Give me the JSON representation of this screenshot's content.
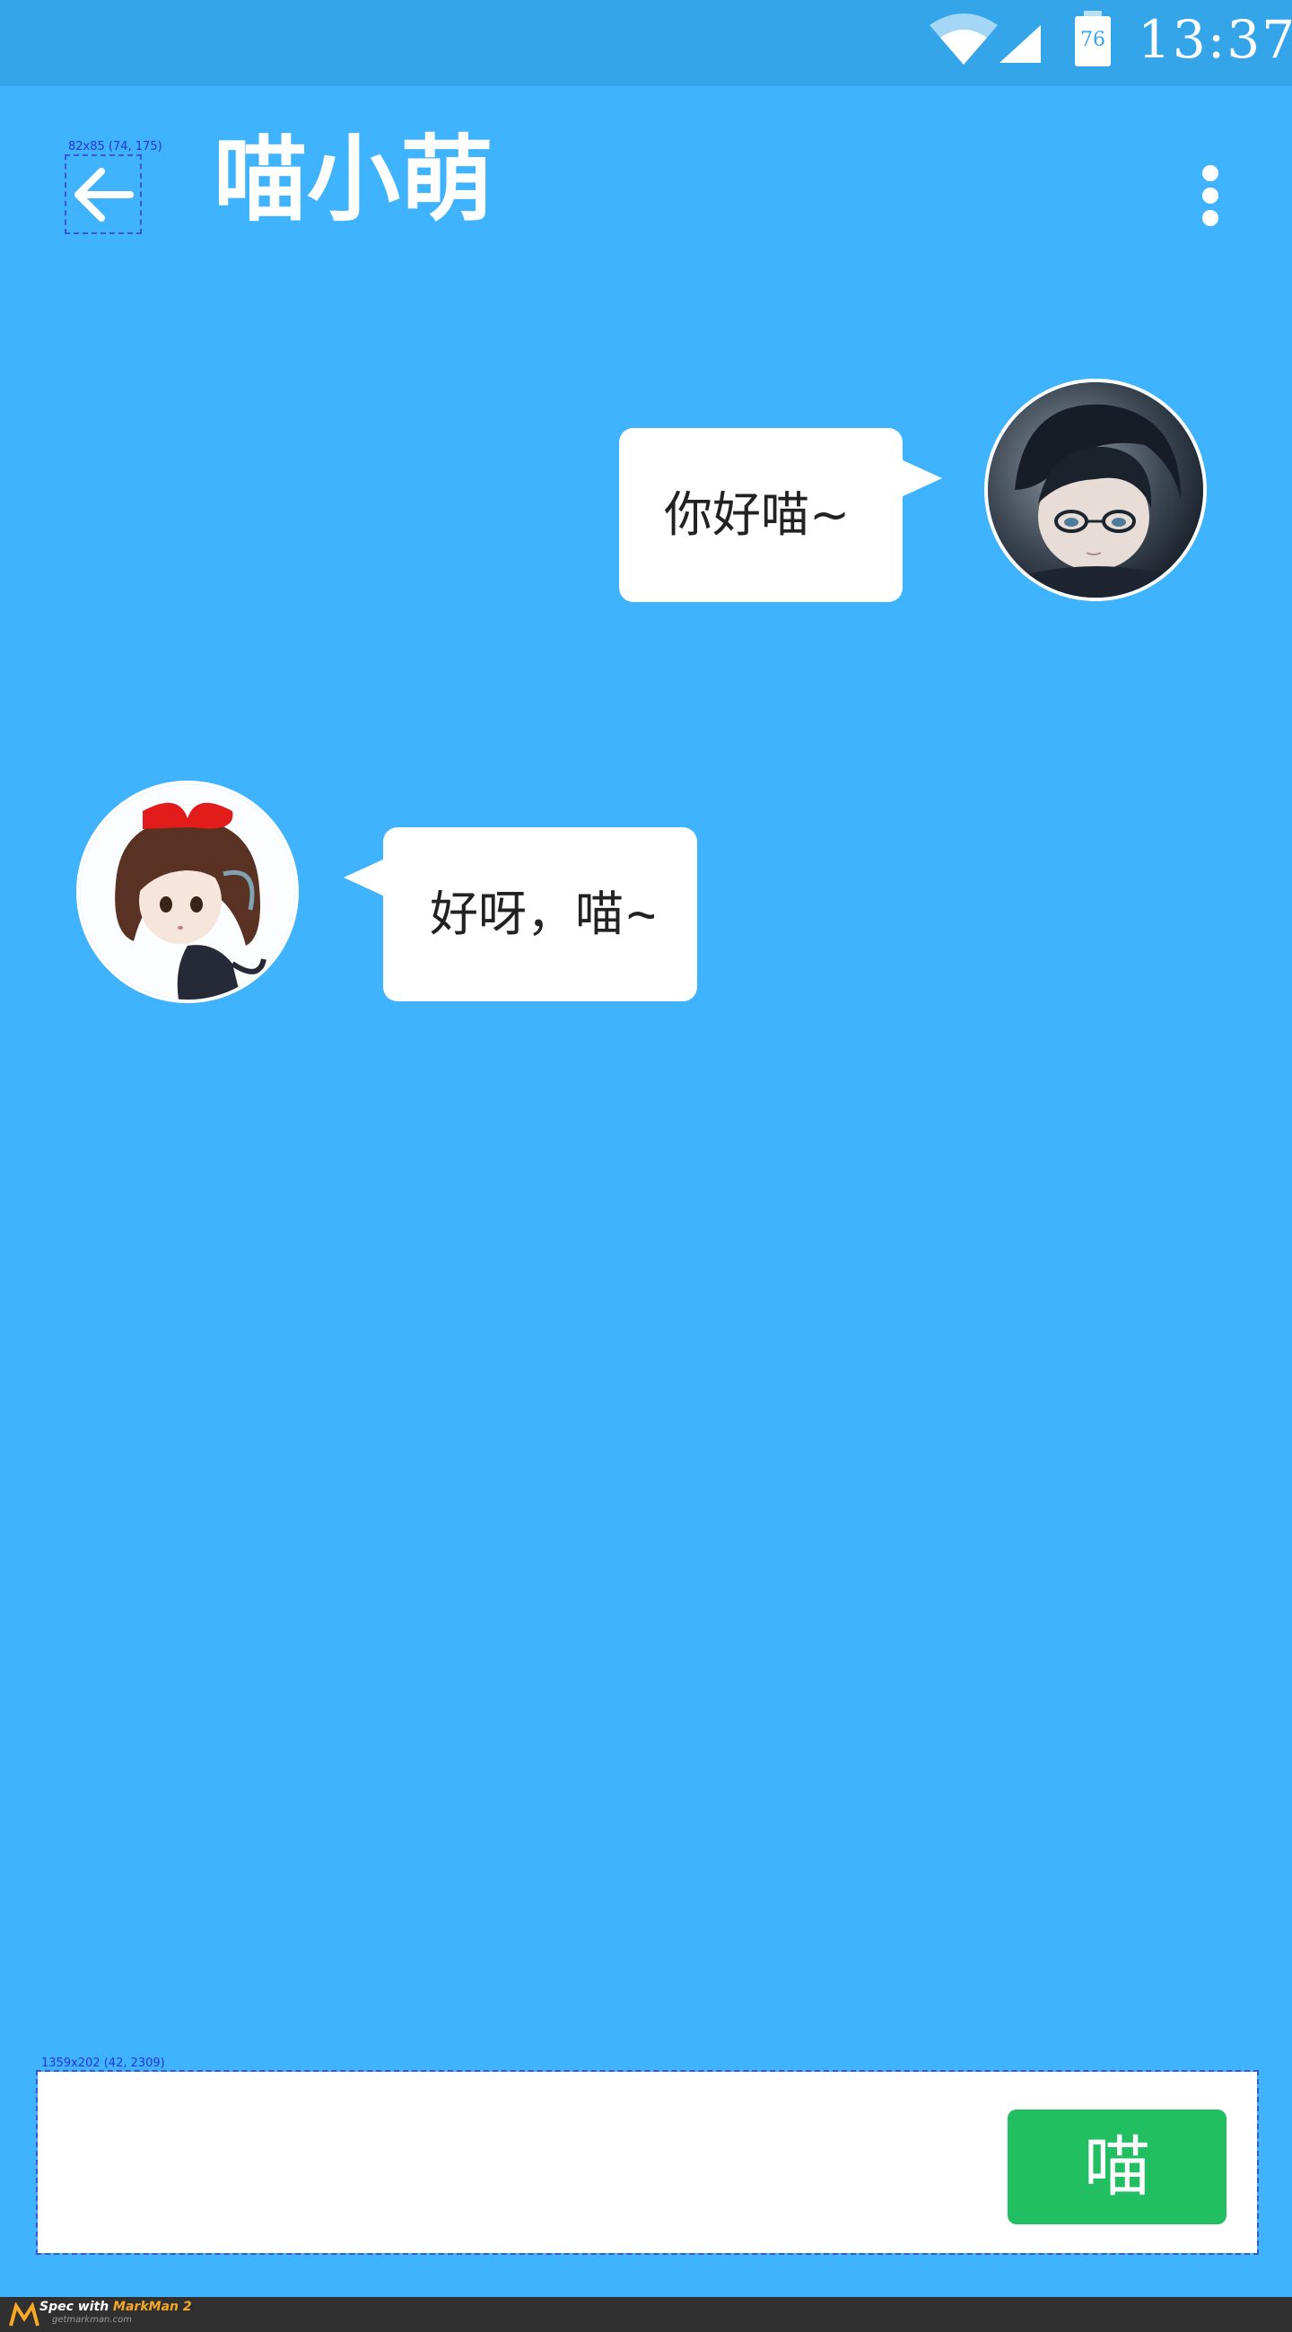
{
  "status_bar": {
    "battery_level": "76",
    "time": "13:37",
    "wifi_icon": "wifi-icon",
    "signal_icon": "cellular-signal-icon",
    "battery_icon": "battery-icon"
  },
  "toolbar": {
    "back_icon": "arrow-left-icon",
    "title": "喵小萌",
    "more_icon": "more-vertical-icon"
  },
  "messages": [
    {
      "side": "right",
      "text": "你好喵~",
      "avatar": "boy-with-glasses-avatar"
    },
    {
      "side": "left",
      "text": "好呀，喵~",
      "avatar": "girl-with-red-bow-avatar"
    }
  ],
  "input": {
    "value": "",
    "placeholder": "",
    "send_label": "喵"
  },
  "spec": {
    "back_label": "82x85 (74, 175)",
    "input_label": "1359x202 (42, 2309)",
    "footer_line1_prefix": "Spec with ",
    "footer_brand": "MarkMan 2",
    "footer_line2": "getmarkman.com"
  },
  "colors": {
    "background": "#3fb3fd",
    "status_bar": "#35a5e9",
    "send_button": "#22bf62",
    "bubble": "#ffffff"
  }
}
